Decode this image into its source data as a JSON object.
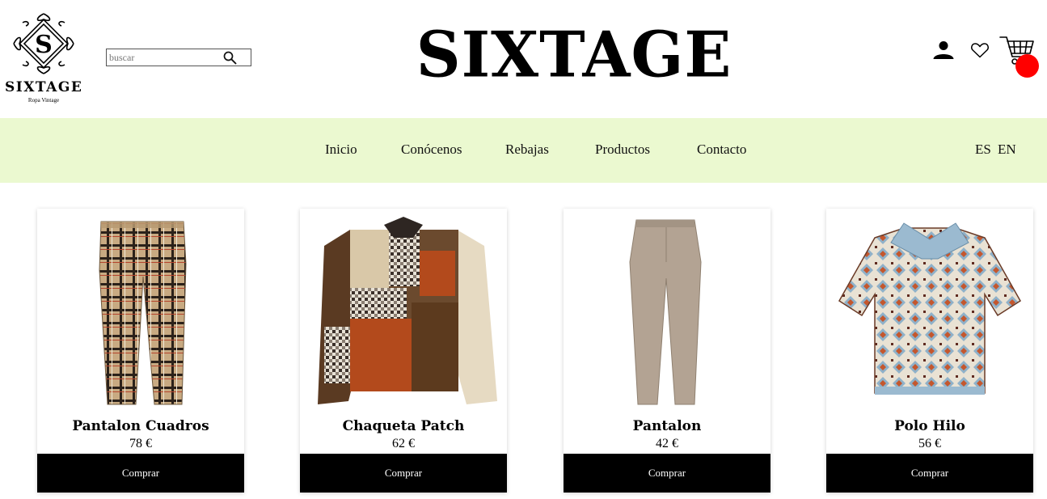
{
  "header": {
    "logo": {
      "name": "SIXTAGE",
      "tagline": "Ropa Vintage",
      "monogram": "S"
    },
    "search": {
      "placeholder": "buscar",
      "value": "",
      "icon": "search-icon"
    },
    "brand_title": "SIXTAGE",
    "icons": {
      "user": "user-icon",
      "wishlist": "heart-icon",
      "cart": "cart-icon"
    },
    "cart_badge_color": "#ff0000"
  },
  "nav": {
    "background": "#ebf9d0",
    "items": [
      {
        "label": "Inicio"
      },
      {
        "label": "Conócenos"
      },
      {
        "label": "Rebajas"
      },
      {
        "label": "Productos"
      },
      {
        "label": "Contacto"
      }
    ],
    "languages": [
      "ES",
      "EN"
    ]
  },
  "products": [
    {
      "name": "Pantalon Cuadros",
      "price": "78 €",
      "buy_label": "Comprar",
      "image": "plaid-trousers"
    },
    {
      "name": "Chaqueta Patch",
      "price": "62 €",
      "buy_label": "Comprar",
      "image": "patchwork-jacket"
    },
    {
      "name": "Pantalon",
      "price": "42 €",
      "buy_label": "Comprar",
      "image": "beige-trousers"
    },
    {
      "name": "Polo Hilo",
      "price": "56 €",
      "buy_label": "Comprar",
      "image": "knit-polo"
    }
  ]
}
